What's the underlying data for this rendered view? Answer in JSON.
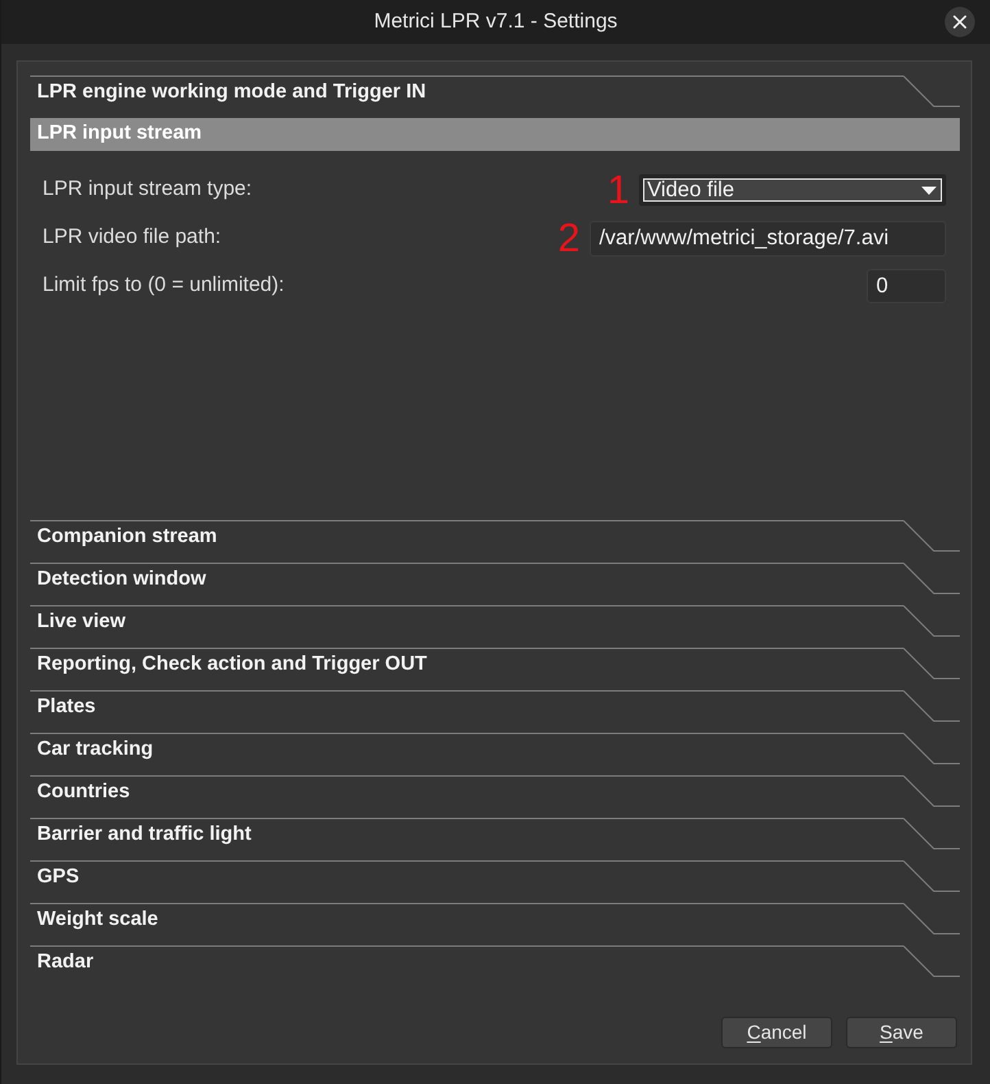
{
  "window": {
    "title": "Metrici LPR v7.1 - Settings"
  },
  "sections": [
    {
      "title": "LPR engine working mode and Trigger IN",
      "expanded": false
    },
    {
      "title": "LPR input stream",
      "expanded": true,
      "fields": [
        {
          "kind": "dropdown",
          "label": "LPR input stream type:",
          "value": "Video file",
          "annotation": "1",
          "focused": true
        },
        {
          "kind": "text",
          "label": "LPR video file path:",
          "value": "/var/www/metrici_storage/7.avi",
          "annotation": "2",
          "focused": false
        },
        {
          "kind": "number",
          "label": "Limit fps to (0 = unlimited):",
          "value": "0",
          "focused": false
        }
      ]
    },
    {
      "title": "Companion stream",
      "expanded": false
    },
    {
      "title": "Detection window",
      "expanded": false
    },
    {
      "title": "Live view",
      "expanded": false
    },
    {
      "title": "Reporting, Check action and Trigger OUT",
      "expanded": false
    },
    {
      "title": "Plates",
      "expanded": false
    },
    {
      "title": "Car tracking",
      "expanded": false
    },
    {
      "title": "Countries",
      "expanded": false
    },
    {
      "title": "Barrier and traffic light",
      "expanded": false
    },
    {
      "title": "GPS",
      "expanded": false
    },
    {
      "title": "Weight scale",
      "expanded": false
    },
    {
      "title": "Radar",
      "expanded": false
    }
  ],
  "buttons": [
    {
      "label": "Cancel",
      "underline_first": true
    },
    {
      "label": "Save",
      "underline_first": true
    }
  ]
}
